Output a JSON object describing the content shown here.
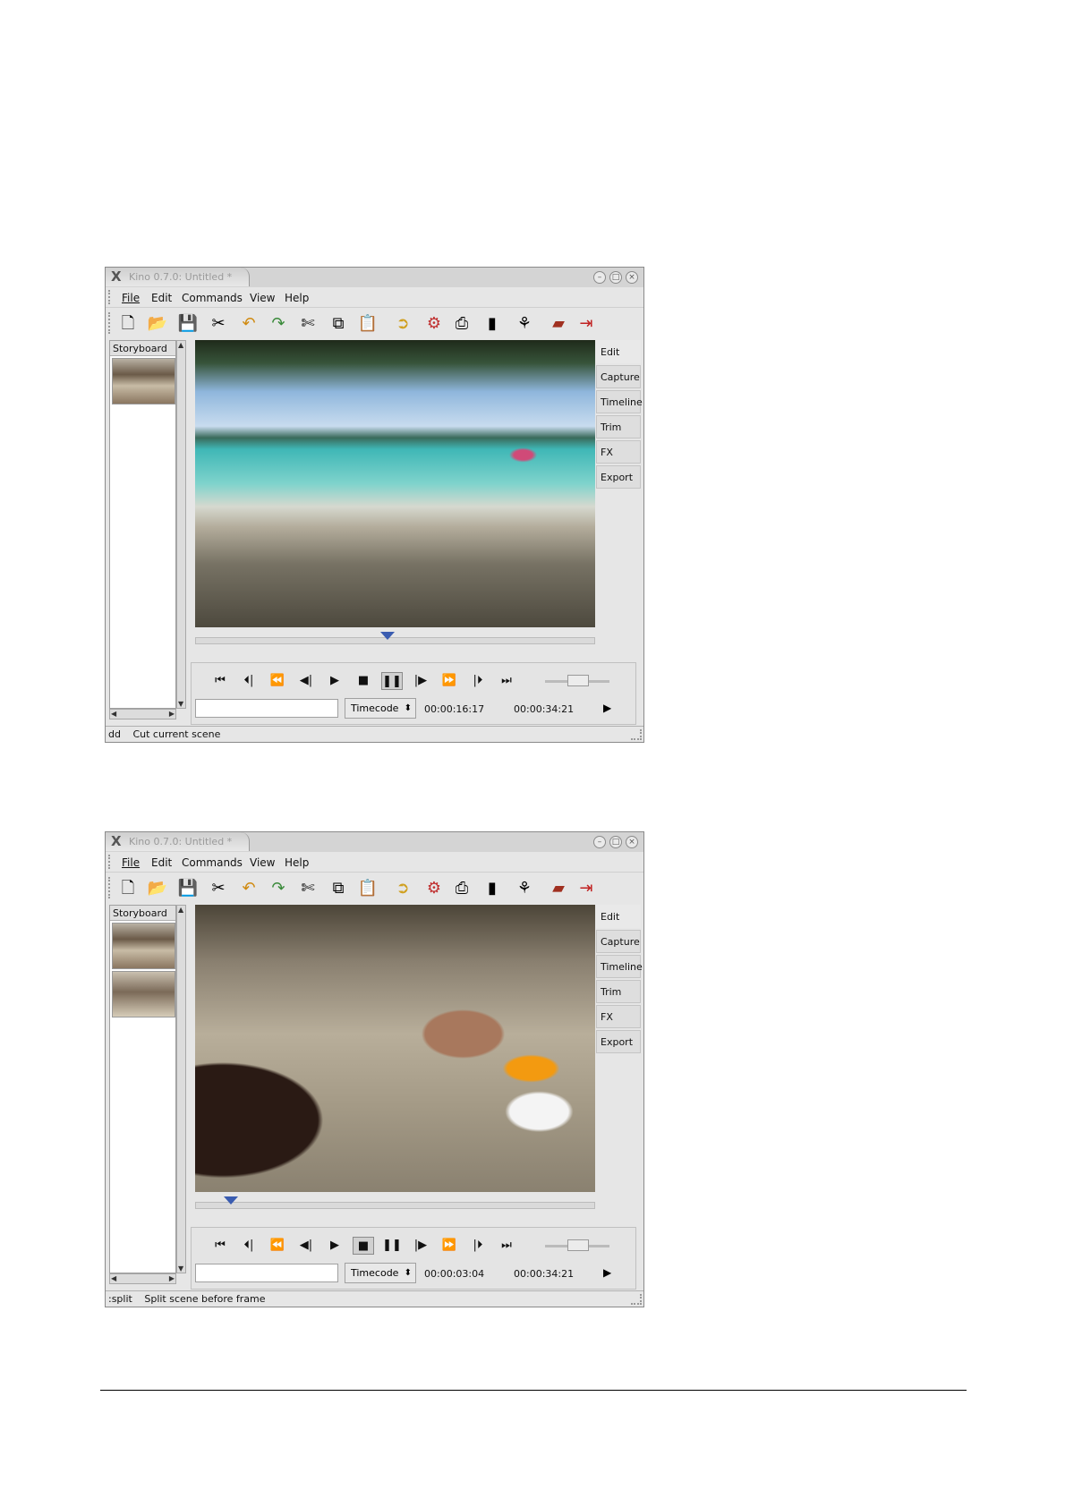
{
  "windows": [
    {
      "title": "Kino 0.7.0: Untitled *",
      "menu": [
        "File",
        "Edit",
        "Commands",
        "View",
        "Help"
      ],
      "storyboard_label": "Storyboard",
      "tabs": [
        "Edit",
        "Capture",
        "Timeline",
        "Trim",
        "FX",
        "Export"
      ],
      "timecode_mode": "Timecode",
      "current_time": "00:00:16:17",
      "total_time": "00:00:34:21",
      "status_cmd": "dd",
      "status_text": "Cut current scene",
      "pressed_transport": "pause",
      "scrub_position": 0.48
    },
    {
      "title": "Kino 0.7.0: Untitled *",
      "menu": [
        "File",
        "Edit",
        "Commands",
        "View",
        "Help"
      ],
      "storyboard_label": "Storyboard",
      "tabs": [
        "Edit",
        "Capture",
        "Timeline",
        "Trim",
        "FX",
        "Export"
      ],
      "timecode_mode": "Timecode",
      "current_time": "00:00:03:04",
      "total_time": "00:00:34:21",
      "status_cmd": ":split",
      "status_text": "Split scene before frame",
      "pressed_transport": "stop",
      "scrub_position": 0.09
    }
  ],
  "icons": {
    "toolbar": [
      "new-file-icon",
      "open-folder-icon",
      "save-icon",
      "preferences-icon",
      "undo-icon",
      "redo-icon",
      "cut-icon",
      "copy-icon",
      "paste-icon",
      "capture-icon",
      "fx-icon",
      "export-icon",
      "clip-icon",
      "scene-icon",
      "book-icon",
      "exit-icon"
    ],
    "transport": [
      "go-start-icon",
      "prev-scene-icon",
      "rewind-icon",
      "step-back-icon",
      "play-icon",
      "stop-icon",
      "pause-icon",
      "step-forward-icon",
      "fast-forward-icon",
      "next-scene-icon",
      "go-end-icon"
    ]
  }
}
